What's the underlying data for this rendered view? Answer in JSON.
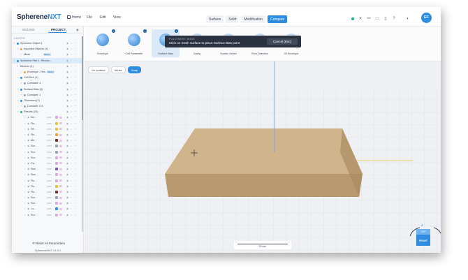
{
  "app": {
    "logo_main": "Spherene",
    "logo_accent": "NXT"
  },
  "menu": {
    "home": "Home",
    "file": "File",
    "edit": "Edit",
    "view": "View"
  },
  "modes": [
    "Surface",
    "Solid",
    "Modification",
    "Compute"
  ],
  "active_mode": "Compute",
  "toolbar_icons": [
    "status-dot",
    "close",
    "link",
    "chat",
    "document",
    "help",
    "theme"
  ],
  "user": {
    "initials": "EC"
  },
  "left_panel": {
    "tab_wizard": "WIZARD",
    "tab_project": "PROJECT",
    "layers_label": "LAYERS",
    "reset_label": "Reset All Parameters",
    "version": "SphereneNXT v1.0.1"
  },
  "tree": [
    {
      "indent": 0,
      "label": "Spherene Object 1",
      "dot": "#2e8de0"
    },
    {
      "indent": 1,
      "label": "Imported Objects (1)",
      "dot": "#f0a03a"
    },
    {
      "indent": 2,
      "label": "Mesh",
      "badge": "MESH"
    },
    {
      "indent": 0,
      "label": "Spherene Part 1: Rectan...",
      "selected": true,
      "dot": "#2e8de0"
    },
    {
      "indent": 1,
      "label": "Meshes (1)"
    },
    {
      "indent": 2,
      "label": "Envelope - Rec...",
      "badge": "MESH",
      "dot": "#f0a03a"
    },
    {
      "indent": 1,
      "label": "Cell Size (1)",
      "dot": "#2e8de0"
    },
    {
      "indent": 2,
      "label": "Constant: 4",
      "dot": "#9aa3b2"
    },
    {
      "indent": 1,
      "label": "Surface Bias (0)",
      "dot": "#2e8de0"
    },
    {
      "indent": 2,
      "label": "Constant: 1",
      "dot": "#9aa3b2"
    },
    {
      "indent": 1,
      "label": "Thickness (1)",
      "dot": "#2e8de0"
    },
    {
      "indent": 2,
      "label": "Constant: 0.5",
      "dot": "#9aa3b2"
    },
    {
      "indent": 1,
      "label": "Results (20)",
      "dot": "#18b07b"
    },
    {
      "indent": 3,
      "label": "Ne...",
      "color": "#d9a7e0"
    },
    {
      "indent": 3,
      "label": "Flo...",
      "color": "#e8c23a"
    },
    {
      "indent": 3,
      "label": "Tff...",
      "color": "#e8c23a"
    },
    {
      "indent": 3,
      "label": "Flo...",
      "color": "#f0a03a"
    },
    {
      "indent": 3,
      "label": "Me...",
      "color": "#7a2c2c"
    },
    {
      "indent": 3,
      "label": "Sur...",
      "color": "#9aa3b2"
    },
    {
      "indent": 3,
      "label": "Sur...",
      "color": "#9aa3b2"
    },
    {
      "indent": 3,
      "label": "Sur...",
      "color": "#d9a7e0"
    },
    {
      "indent": 3,
      "label": "Ca...",
      "color": "#d9a7e0"
    },
    {
      "indent": 3,
      "label": "Sca...",
      "color": "#7a5cb8"
    },
    {
      "indent": 3,
      "label": "Sca...",
      "color": "#d9a7e0"
    },
    {
      "indent": 3,
      "label": "Flo...",
      "color": "#d9a7e0"
    },
    {
      "indent": 3,
      "label": "Flo...",
      "color": "#e8c23a"
    },
    {
      "indent": 3,
      "label": "Flo...",
      "color": "#7a2c2c"
    },
    {
      "indent": 3,
      "label": "Sur...",
      "color": "#9aa3b2"
    },
    {
      "indent": 3,
      "label": "Sur...",
      "color": "#d9a7e0"
    },
    {
      "indent": 3,
      "label": "Lo...",
      "color": "#2e8de0"
    },
    {
      "indent": 3,
      "label": "Sur...",
      "color": "#d9a7e0"
    }
  ],
  "result_meta": "1000",
  "tools": [
    {
      "label": "Envelope",
      "plus": true
    },
    {
      "label": "Cell Parameter",
      "plus": true
    },
    {
      "label": "Surface Bias",
      "plus": true,
      "active": true
    },
    {
      "label": "Cavity",
      "dim": true
    },
    {
      "label": "Scatter Vector",
      "dim": true
    },
    {
      "label": "Flow Direction",
      "dim": true
    },
    {
      "label": "Of Envelope",
      "dim": true
    }
  ],
  "banner": {
    "caption": "PLACEMENT MODE",
    "message": "Click on mesh surface to place Surface Bias point",
    "cancel": "Cancel (Esc)"
  },
  "viewport": {
    "modes": [
      "On surface",
      "Vertex",
      "Snap"
    ],
    "active_mode": "Snap",
    "scale_label": "20 mm",
    "axis_z": "Z",
    "cube_top": "TOP",
    "cube_front": "FRONT"
  }
}
